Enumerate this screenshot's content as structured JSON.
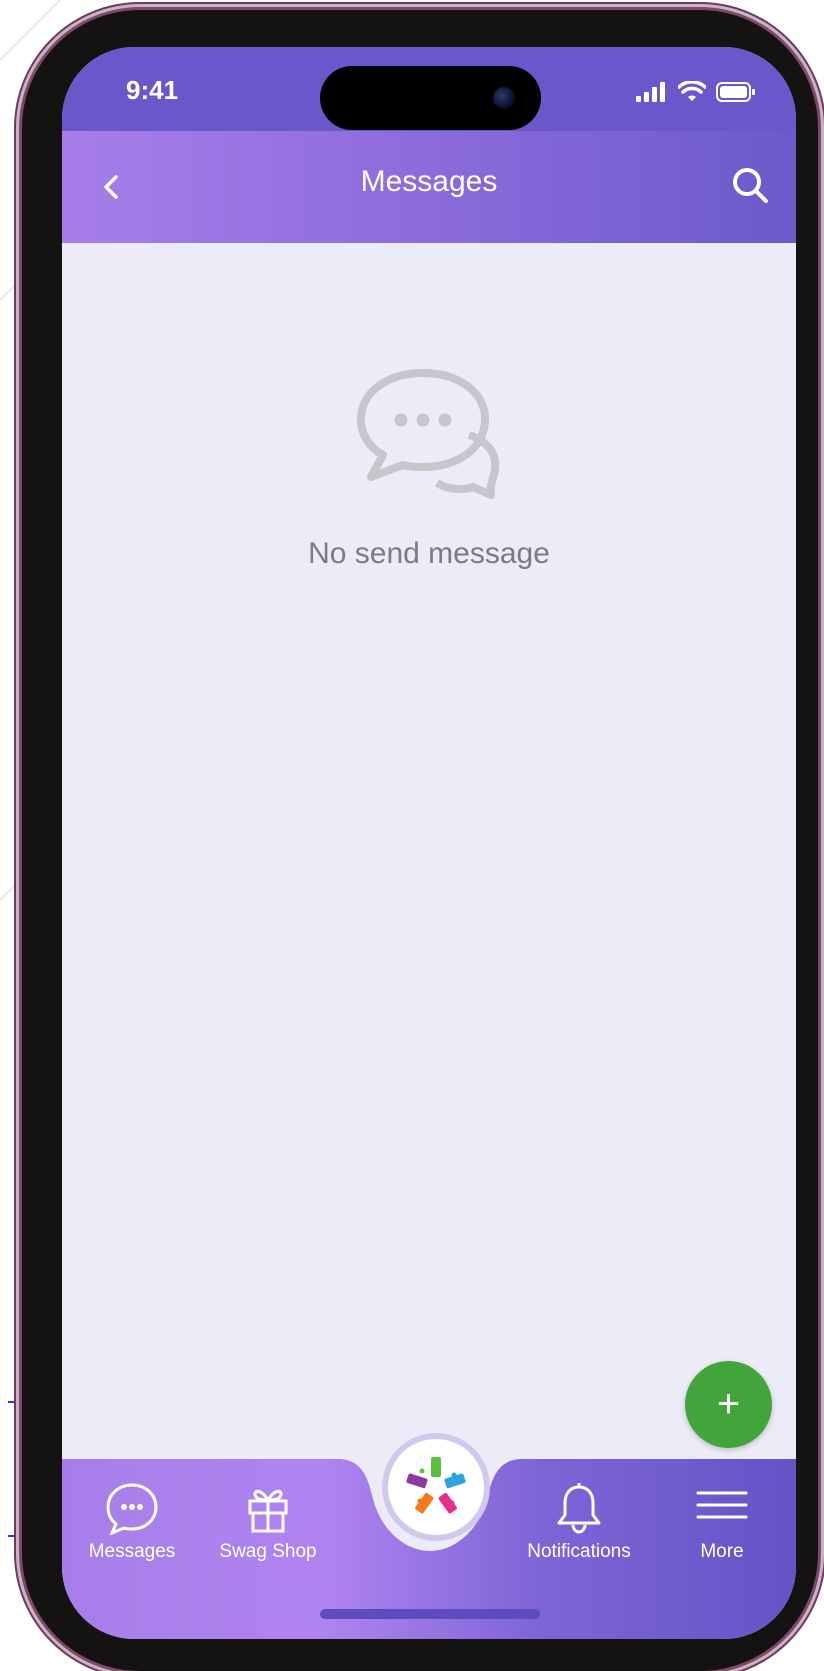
{
  "status_bar": {
    "time": "9:41"
  },
  "header": {
    "title": "Messages"
  },
  "empty_state": {
    "text": "No send message"
  },
  "fab": {
    "label": "+"
  },
  "bottom_nav": {
    "items": [
      {
        "label": "Messages",
        "icon": "chat-bubble-icon"
      },
      {
        "label": "Swag Shop",
        "icon": "gift-icon"
      },
      {
        "label": "Notifications",
        "icon": "bell-icon"
      },
      {
        "label": "More",
        "icon": "menu-icon"
      }
    ],
    "center_icon": "tags-logo-icon"
  },
  "colors": {
    "header_start": "#a77ee9",
    "header_end": "#6b5ac9",
    "status_bar": "#6a57c9",
    "screen_background": "#ecebf8",
    "fab": "#43a43b",
    "empty_text": "#7c7c80"
  }
}
